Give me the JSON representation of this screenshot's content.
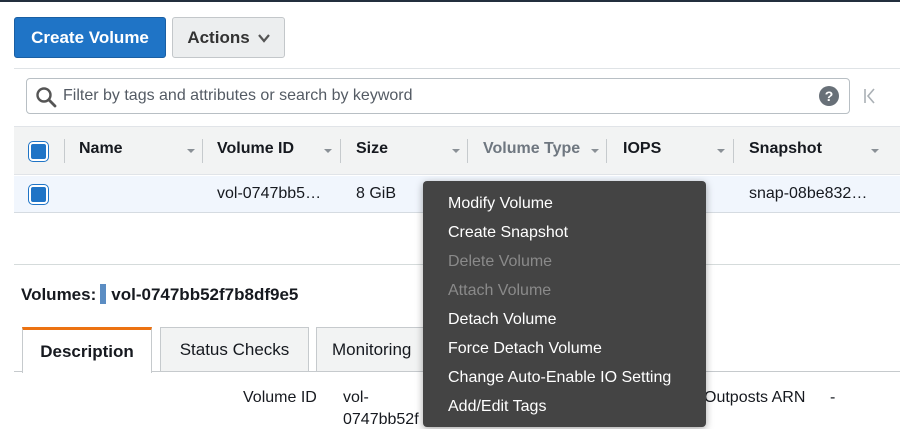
{
  "toolbar": {
    "create_label": "Create Volume",
    "actions_label": "Actions",
    "primary_color": "#1f74c6"
  },
  "filter": {
    "placeholder": "Filter by tags and attributes or search by keyword",
    "search_icon": "search-icon",
    "help_icon": "?",
    "first_page_icon": "first-page-icon"
  },
  "table": {
    "columns": [
      "Name",
      "Volume ID",
      "Size",
      "Volume Type",
      "IOPS",
      "Snapshot"
    ],
    "rows": [
      {
        "name": "",
        "volume_id": "vol-0747bb5…",
        "size": "8 GiB",
        "snapshot": "snap-08be832…",
        "selected": true
      }
    ]
  },
  "details": {
    "title_prefix": "Volumes:",
    "title_id": "vol-0747bb52f7b8df9e5",
    "tabs": [
      "Description",
      "Status Checks",
      "Monitoring"
    ],
    "active_tab": "Description",
    "volume_id_label": "Volume ID",
    "volume_id_value_line1": "vol-",
    "volume_id_value_line2": "0747bb52f",
    "outposts_label": "Outposts ARN",
    "outposts_value": "-"
  },
  "context_menu": {
    "items": [
      {
        "label": "Modify Volume",
        "enabled": true
      },
      {
        "label": "Create Snapshot",
        "enabled": true
      },
      {
        "label": "Delete Volume",
        "enabled": false
      },
      {
        "label": "Attach Volume",
        "enabled": false
      },
      {
        "label": "Detach Volume",
        "enabled": true
      },
      {
        "label": "Force Detach Volume",
        "enabled": true
      },
      {
        "label": "Change Auto-Enable IO Setting",
        "enabled": true
      },
      {
        "label": "Add/Edit Tags",
        "enabled": true
      }
    ]
  },
  "colors": {
    "menu_bg": "#444444",
    "selected_row_bg": "#f1f6fd",
    "active_tab_accent": "#ec7211"
  }
}
